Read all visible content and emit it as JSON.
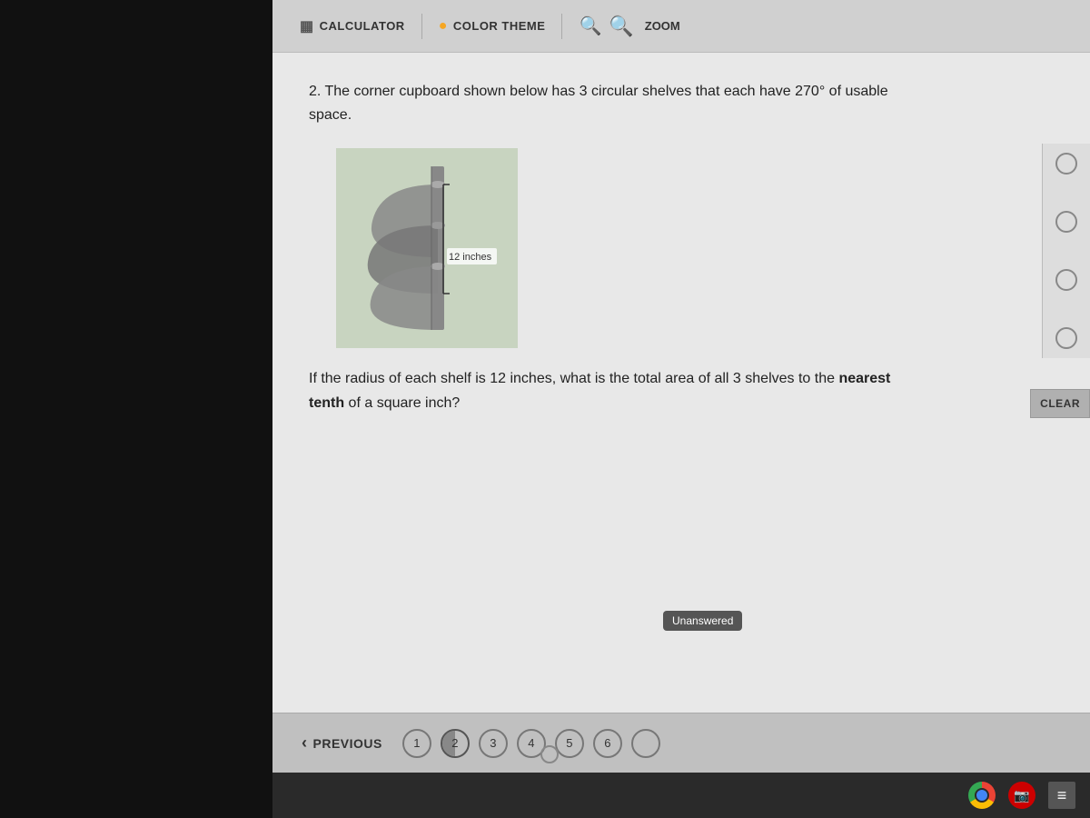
{
  "toolbar": {
    "calculator_label": "CALCULATOR",
    "color_theme_label": "COLOR THEME",
    "zoom_label": "ZOOM"
  },
  "question": {
    "number": "2.",
    "text": "The corner cupboard shown below has 3 circular shelves that each have 270° of usable space.",
    "image_label": "12 inches",
    "followup": "If the radius of each shelf is 12 inches, what is the total area of all 3 shelves to the nearest tenth of a square inch?",
    "followup_bold": "nearest tenth",
    "followup_rest": " of a square inch?"
  },
  "options": {
    "clear_label": "CLEAR",
    "unanswered_label": "Unanswered"
  },
  "navigation": {
    "previous_label": "PREVIOUS",
    "items": [
      {
        "num": "1",
        "active": false
      },
      {
        "num": "2",
        "active": true
      },
      {
        "num": "3",
        "active": false
      },
      {
        "num": "4",
        "active": false
      },
      {
        "num": "5",
        "active": false
      },
      {
        "num": "6",
        "active": false
      }
    ]
  },
  "icons": {
    "calculator": "▦",
    "color_theme": "●",
    "search_small": "🔍",
    "search_large": "🔍",
    "previous_arrow": "‹",
    "video": "▶",
    "hamburger": "≡"
  }
}
